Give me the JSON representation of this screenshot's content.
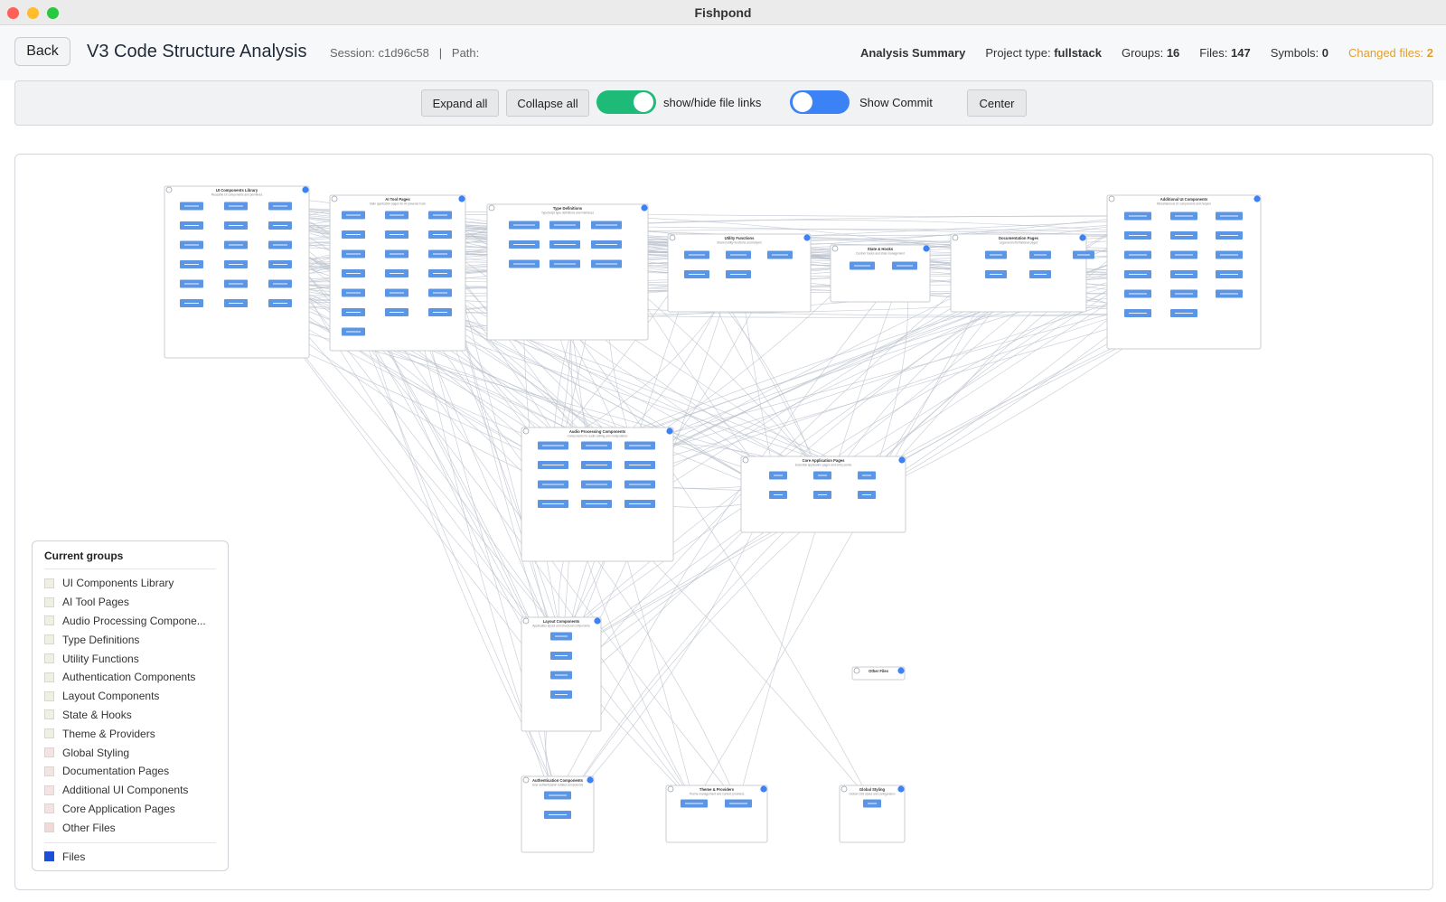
{
  "window": {
    "title": "Fishpond"
  },
  "header": {
    "back_label": "Back",
    "title": "V3 Code Structure Analysis",
    "session": "Session: c1d96c58   |   Path:",
    "summary_label": "Analysis Summary",
    "project_type_label": "Project type:",
    "project_type_value": "fullstack",
    "groups_label": "Groups:",
    "groups_value": "16",
    "files_label": "Files:",
    "files_value": "147",
    "symbols_label": "Symbols:",
    "symbols_value": "0",
    "changed_label": "Changed files:",
    "changed_value": "2"
  },
  "toolbar": {
    "expand_label": "Expand all",
    "collapse_label": "Collapse all",
    "file_links_label": "show/hide file links",
    "file_links_on": true,
    "commit_label": "Show Commit",
    "commit_on": false,
    "center_label": "Center"
  },
  "colors": {
    "group_border": "#c8ccd2",
    "file_node": "#5b95e6",
    "edge": "#b9c0cc",
    "accent": "#3b82f6",
    "files_legend": "#1d4ed8"
  },
  "groups": [
    {
      "title": "UI Components Library",
      "subtitle": "Reusable UI components and primitives",
      "files": 18
    },
    {
      "title": "AI Tool Pages",
      "subtitle": "Main application pages for AI-powered tools",
      "files": 19
    },
    {
      "title": "Type Definitions",
      "subtitle": "TypeScript type definitions and interfaces",
      "files": 9
    },
    {
      "title": "Utility Functions",
      "subtitle": "Shared utility functions and helpers",
      "files": 5
    },
    {
      "title": "State & Hooks",
      "subtitle": "Custom hooks and state management",
      "files": 2
    },
    {
      "title": "Documentation Pages",
      "subtitle": "Legal and informational pages",
      "files": 5
    },
    {
      "title": "Additional UI Components",
      "subtitle": "Miscellaneous UI components and helpers",
      "files": 17
    },
    {
      "title": "Audio Processing Components",
      "subtitle": "Components for audio editing and manipulation",
      "files": 12
    },
    {
      "title": "Core Application Pages",
      "subtitle": "Essential application pages and entry points",
      "files": 6
    },
    {
      "title": "Layout Components",
      "subtitle": "Application layout and structural components",
      "files": 4
    },
    {
      "title": "Other Files",
      "subtitle": "",
      "files": 0
    },
    {
      "title": "Authentication Components",
      "subtitle": "User authentication related components",
      "files": 2
    },
    {
      "title": "Theme & Providers",
      "subtitle": "Theme management and context providers",
      "files": 2
    },
    {
      "title": "Global Styling",
      "subtitle": "Global CSS styles and configuration",
      "files": 1
    }
  ],
  "legend": {
    "title": "Current groups",
    "items": [
      {
        "label": "UI Components Library",
        "color": "#efefe2"
      },
      {
        "label": "AI Tool Pages",
        "color": "#efefe2"
      },
      {
        "label": "Audio Processing Compone...",
        "color": "#efefe2"
      },
      {
        "label": "Type Definitions",
        "color": "#efefe2"
      },
      {
        "label": "Utility Functions",
        "color": "#efefe2"
      },
      {
        "label": "Authentication Components",
        "color": "#efefe2"
      },
      {
        "label": "Layout Components",
        "color": "#efefe2"
      },
      {
        "label": "State & Hooks",
        "color": "#efefe2"
      },
      {
        "label": "Theme & Providers",
        "color": "#efefe2"
      },
      {
        "label": "Global Styling",
        "color": "#f3e3e3"
      },
      {
        "label": "Documentation Pages",
        "color": "#f3e3e3"
      },
      {
        "label": "Additional UI Components",
        "color": "#f3e3e3"
      },
      {
        "label": "Core Application Pages",
        "color": "#f3e3e3"
      },
      {
        "label": "Other Files",
        "color": "#f1d9d9"
      }
    ],
    "files_label": "Files",
    "files_color": "#1d4ed8"
  }
}
